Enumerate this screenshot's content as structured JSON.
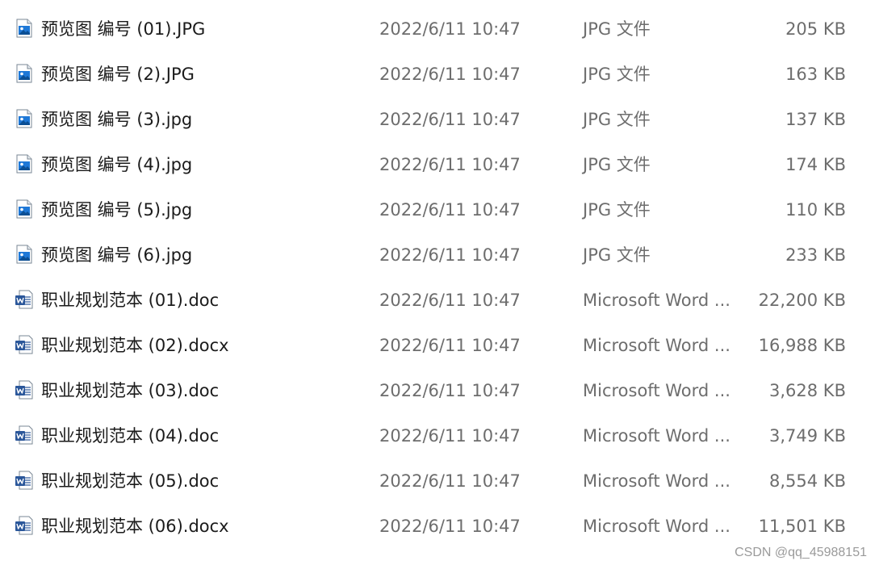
{
  "files": [
    {
      "name": "预览图 编号 (01).JPG",
      "date": "2022/6/11 10:47",
      "type": "JPG 文件",
      "size": "205 KB",
      "icon": "image-file-icon"
    },
    {
      "name": "预览图 编号 (2).JPG",
      "date": "2022/6/11 10:47",
      "type": "JPG 文件",
      "size": "163 KB",
      "icon": "image-file-icon"
    },
    {
      "name": "预览图 编号 (3).jpg",
      "date": "2022/6/11 10:47",
      "type": "JPG 文件",
      "size": "137 KB",
      "icon": "image-file-icon"
    },
    {
      "name": "预览图 编号 (4).jpg",
      "date": "2022/6/11 10:47",
      "type": "JPG 文件",
      "size": "174 KB",
      "icon": "image-file-icon"
    },
    {
      "name": "预览图 编号 (5).jpg",
      "date": "2022/6/11 10:47",
      "type": "JPG 文件",
      "size": "110 KB",
      "icon": "image-file-icon"
    },
    {
      "name": "预览图 编号 (6).jpg",
      "date": "2022/6/11 10:47",
      "type": "JPG 文件",
      "size": "233 KB",
      "icon": "image-file-icon"
    },
    {
      "name": "职业规划范本 (01).doc",
      "date": "2022/6/11 10:47",
      "type": "Microsoft Word ...",
      "size": "22,200 KB",
      "icon": "word-document-icon"
    },
    {
      "name": "职业规划范本 (02).docx",
      "date": "2022/6/11 10:47",
      "type": "Microsoft Word ...",
      "size": "16,988 KB",
      "icon": "word-document-icon"
    },
    {
      "name": "职业规划范本 (03).doc",
      "date": "2022/6/11 10:47",
      "type": "Microsoft Word ...",
      "size": "3,628 KB",
      "icon": "word-document-icon"
    },
    {
      "name": "职业规划范本 (04).doc",
      "date": "2022/6/11 10:47",
      "type": "Microsoft Word ...",
      "size": "3,749 KB",
      "icon": "word-document-icon"
    },
    {
      "name": "职业规划范本 (05).doc",
      "date": "2022/6/11 10:47",
      "type": "Microsoft Word ...",
      "size": "8,554 KB",
      "icon": "word-document-icon"
    },
    {
      "name": "职业规划范本 (06).docx",
      "date": "2022/6/11 10:47",
      "type": "Microsoft Word ...",
      "size": "11,501 KB",
      "icon": "word-document-icon"
    }
  ],
  "watermark": "CSDN @qq_45988151",
  "colors": {
    "name_text": "#1b1b1b",
    "detail_text": "#6d6d6d",
    "word_blue": "#2b579a",
    "image_blue": "#1e78d7"
  }
}
